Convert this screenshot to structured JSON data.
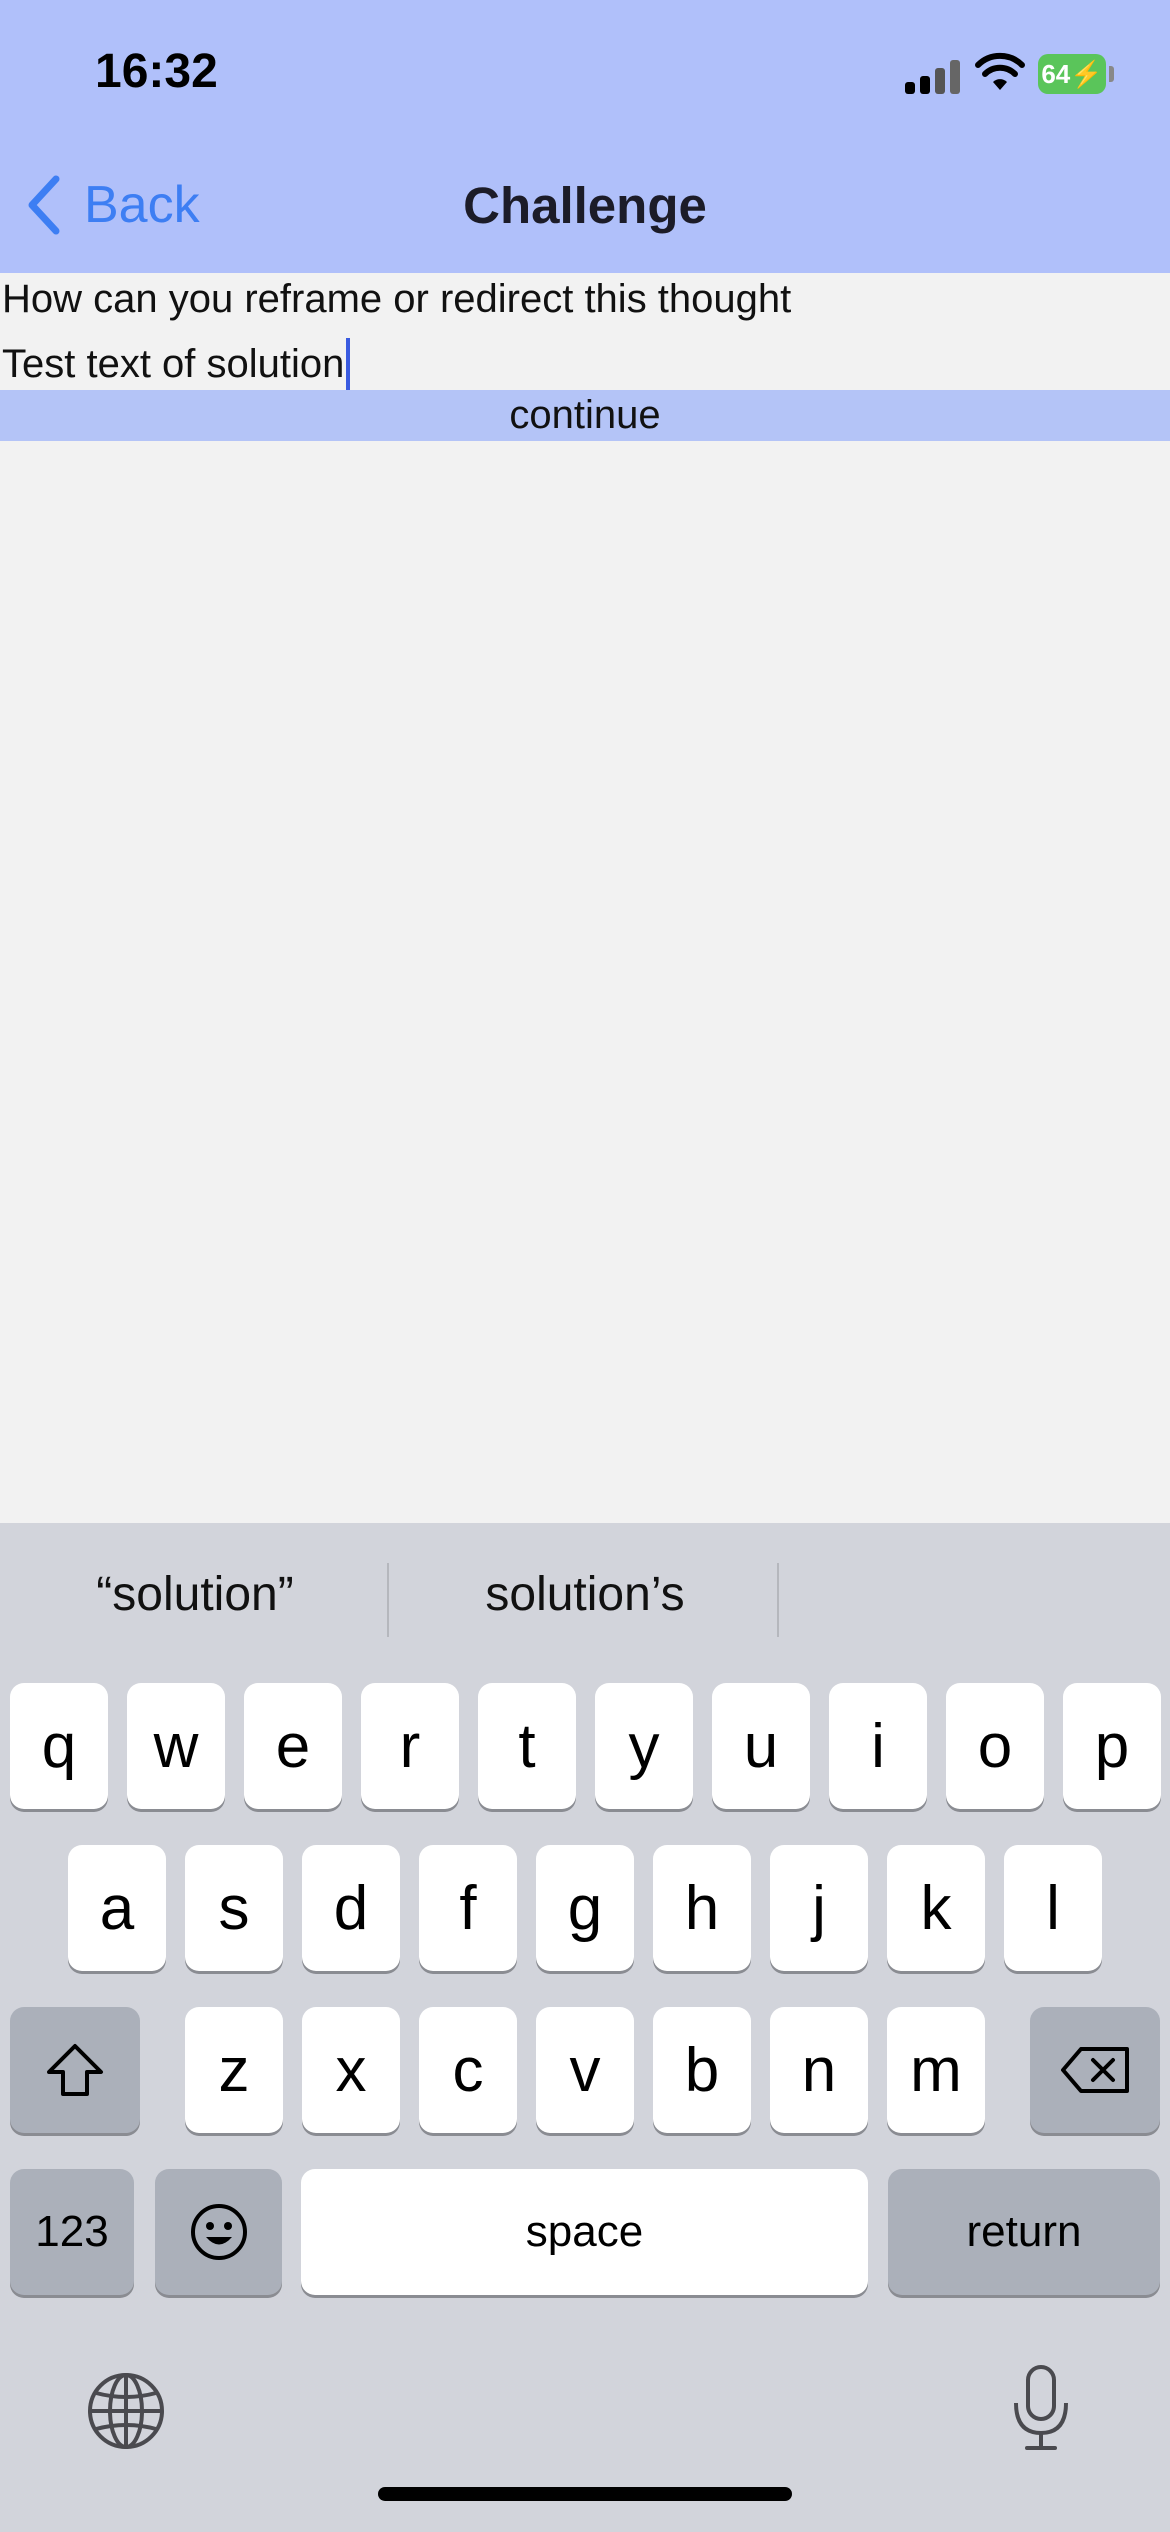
{
  "status_bar": {
    "time": "16:32",
    "battery": "64"
  },
  "nav": {
    "back_label": "Back",
    "title": "Challenge"
  },
  "content": {
    "prompt": "How can you reframe or redirect this thought",
    "answer_value": "Test text of solution",
    "continue_label": "continue"
  },
  "keyboard": {
    "suggestions": [
      "“solution”",
      "solution’s",
      ""
    ],
    "row1": [
      "q",
      "w",
      "e",
      "r",
      "t",
      "y",
      "u",
      "i",
      "o",
      "p"
    ],
    "row2": [
      "a",
      "s",
      "d",
      "f",
      "g",
      "h",
      "j",
      "k",
      "l"
    ],
    "row3": [
      "z",
      "x",
      "c",
      "v",
      "b",
      "n",
      "m"
    ],
    "numbers_label": "123",
    "space_label": "space",
    "return_label": "return"
  },
  "colors": {
    "header_bg": "#b0c0fa",
    "accent": "#3d7ef3",
    "continue_bg": "#b4c4f7"
  }
}
